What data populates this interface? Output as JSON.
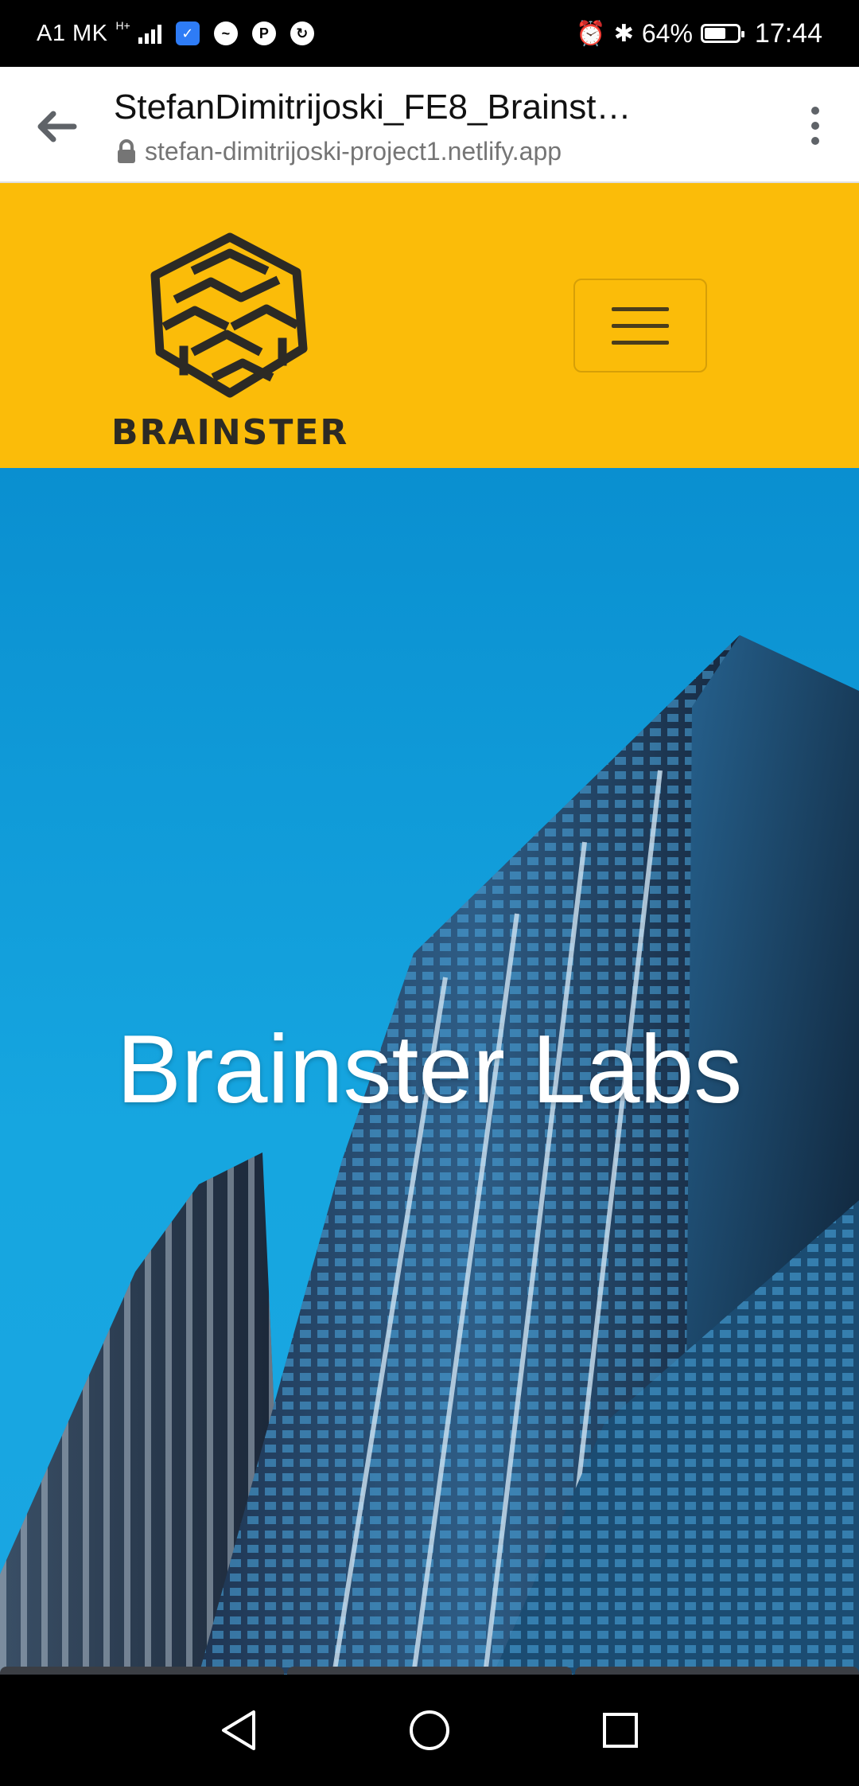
{
  "status_bar": {
    "carrier": "A1 MK",
    "network_type": "H+",
    "battery_percent": "64%",
    "battery_level": 0.64,
    "time": "17:44",
    "notification_icons": [
      "shield-icon",
      "messenger-icon",
      "pinterest-icon",
      "sync-icon"
    ]
  },
  "browser": {
    "page_title": "StefanDimitrijoski_FE8_Brainst…",
    "url": "stefan-dimitrijoski-project1.netlify.app"
  },
  "site": {
    "brand_name": "BRAINSTER",
    "brand_color": "#fbbc09",
    "hero_title": "Brainster Labs"
  },
  "android_nav": {
    "buttons": [
      "back-icon",
      "home-icon",
      "recents-icon"
    ]
  }
}
